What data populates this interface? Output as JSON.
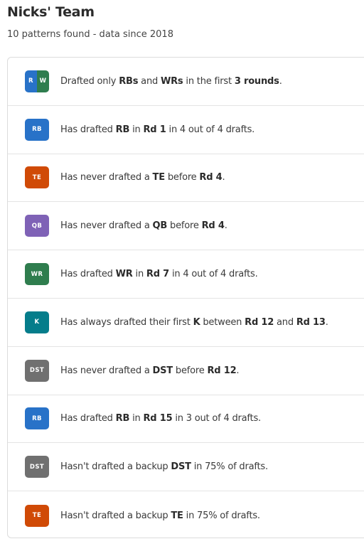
{
  "header": {
    "title": "Nicks' Team",
    "subtitle": "10 patterns found - data since 2018"
  },
  "colors": {
    "RB": "#2872c8",
    "WR": "#2f7d4e",
    "TE": "#d04a06",
    "QB": "#7f62b6",
    "K": "#057d8b",
    "DST": "#707070"
  },
  "patterns": [
    {
      "badge": [
        "R",
        "W"
      ],
      "badge_colors": [
        "RB",
        "WR"
      ],
      "segments": [
        {
          "t": "Drafted only "
        },
        {
          "t": "RBs",
          "b": true
        },
        {
          "t": " and "
        },
        {
          "t": "WRs",
          "b": true
        },
        {
          "t": " in the first "
        },
        {
          "t": "3 rounds",
          "b": true
        },
        {
          "t": "."
        }
      ]
    },
    {
      "badge": [
        "RB"
      ],
      "badge_colors": [
        "RB"
      ],
      "segments": [
        {
          "t": "Has drafted "
        },
        {
          "t": "RB",
          "b": true
        },
        {
          "t": " in "
        },
        {
          "t": "Rd 1",
          "b": true
        },
        {
          "t": " in 4 out of 4 drafts."
        }
      ]
    },
    {
      "badge": [
        "TE"
      ],
      "badge_colors": [
        "TE"
      ],
      "segments": [
        {
          "t": "Has never drafted a "
        },
        {
          "t": "TE",
          "b": true
        },
        {
          "t": " before "
        },
        {
          "t": "Rd 4",
          "b": true
        },
        {
          "t": "."
        }
      ]
    },
    {
      "badge": [
        "QB"
      ],
      "badge_colors": [
        "QB"
      ],
      "segments": [
        {
          "t": "Has never drafted a "
        },
        {
          "t": "QB",
          "b": true
        },
        {
          "t": " before "
        },
        {
          "t": "Rd 4",
          "b": true
        },
        {
          "t": "."
        }
      ]
    },
    {
      "badge": [
        "WR"
      ],
      "badge_colors": [
        "WR"
      ],
      "segments": [
        {
          "t": "Has drafted "
        },
        {
          "t": "WR",
          "b": true
        },
        {
          "t": " in "
        },
        {
          "t": "Rd 7",
          "b": true
        },
        {
          "t": " in 4 out of 4 drafts."
        }
      ]
    },
    {
      "badge": [
        "K"
      ],
      "badge_colors": [
        "K"
      ],
      "segments": [
        {
          "t": "Has always drafted their first "
        },
        {
          "t": "K",
          "b": true
        },
        {
          "t": " between "
        },
        {
          "t": "Rd 12",
          "b": true
        },
        {
          "t": " and "
        },
        {
          "t": "Rd 13",
          "b": true
        },
        {
          "t": "."
        }
      ]
    },
    {
      "badge": [
        "DST"
      ],
      "badge_colors": [
        "DST"
      ],
      "segments": [
        {
          "t": "Has never drafted a "
        },
        {
          "t": "DST",
          "b": true
        },
        {
          "t": " before "
        },
        {
          "t": "Rd 12",
          "b": true
        },
        {
          "t": "."
        }
      ]
    },
    {
      "badge": [
        "RB"
      ],
      "badge_colors": [
        "RB"
      ],
      "segments": [
        {
          "t": "Has drafted "
        },
        {
          "t": "RB",
          "b": true
        },
        {
          "t": " in "
        },
        {
          "t": "Rd 15",
          "b": true
        },
        {
          "t": " in 3 out of 4 drafts."
        }
      ]
    },
    {
      "badge": [
        "DST"
      ],
      "badge_colors": [
        "DST"
      ],
      "segments": [
        {
          "t": "Hasn't drafted a backup "
        },
        {
          "t": "DST",
          "b": true
        },
        {
          "t": " in 75% of drafts."
        }
      ]
    },
    {
      "badge": [
        "TE"
      ],
      "badge_colors": [
        "TE"
      ],
      "segments": [
        {
          "t": "Hasn't drafted a backup "
        },
        {
          "t": "TE",
          "b": true
        },
        {
          "t": " in 75% of drafts."
        }
      ]
    }
  ]
}
